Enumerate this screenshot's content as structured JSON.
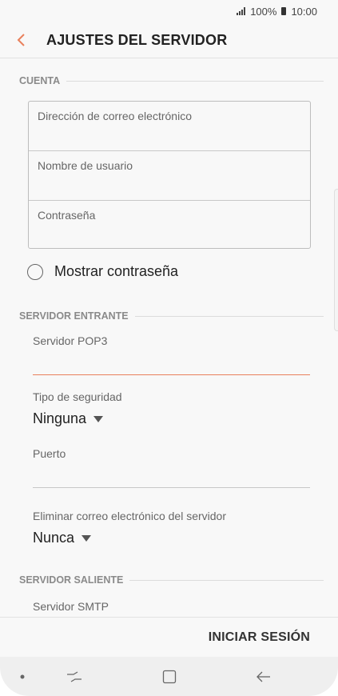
{
  "status_bar": {
    "battery": "100%",
    "time": "10:00"
  },
  "header": {
    "title": "AJUSTES DEL SERVIDOR",
    "back_icon": "chevron-left-icon",
    "accent_color": "#e9805c"
  },
  "cuenta": {
    "section_title": "CUENTA",
    "email_placeholder": "Dirección de correo electrónico",
    "username_placeholder": "Nombre de usuario",
    "password_placeholder": "Contraseña",
    "show_password_label": "Mostrar contraseña"
  },
  "incoming": {
    "section_title": "SERVIDOR ENTRANTE",
    "server_label": "Servidor POP3",
    "server_value": "",
    "security_label": "Tipo de seguridad",
    "security_value": "Ninguna",
    "port_label": "Puerto",
    "port_value": "",
    "delete_label": "Eliminar correo electrónico del servidor",
    "delete_value": "Nunca"
  },
  "outgoing": {
    "section_title": "SERVIDOR SALIENTE",
    "server_label": "Servidor SMTP"
  },
  "footer": {
    "login_label": "INICIAR SESIÓN"
  },
  "navbar": {
    "items": [
      "dot-icon",
      "recent-apps-icon",
      "home-icon",
      "back-arrow-icon"
    ]
  }
}
